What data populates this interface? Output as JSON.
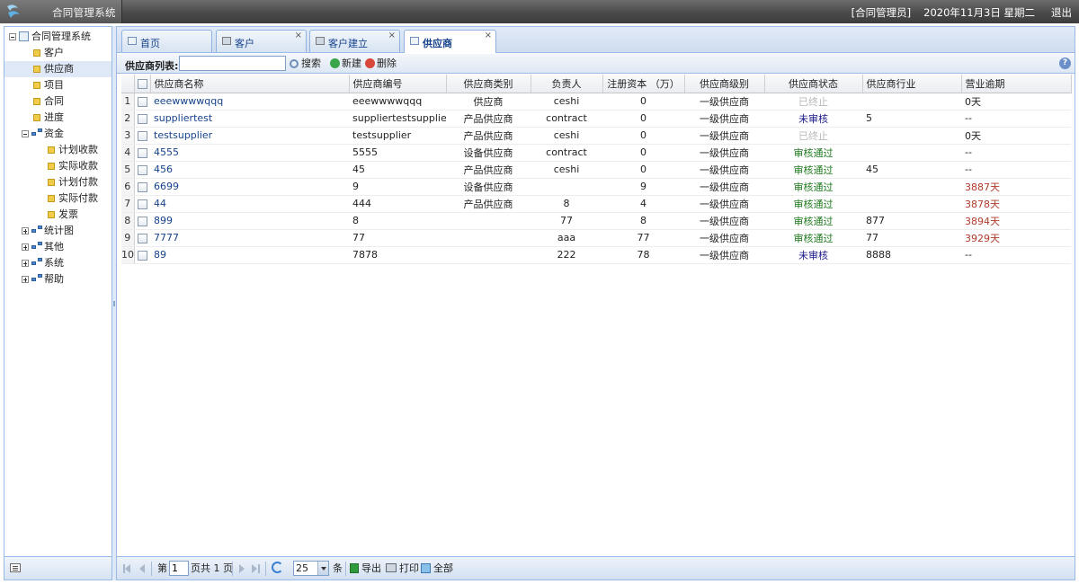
{
  "header": {
    "app_title": "合同管理系统",
    "user": "[合同管理员]",
    "date": "2020年11月3日 星期二",
    "logout": "退出"
  },
  "tree": {
    "root": "合同管理系统",
    "items": [
      {
        "label": "客户",
        "level": 1,
        "selected": false
      },
      {
        "label": "供应商",
        "level": 1,
        "selected": true
      },
      {
        "label": "项目",
        "level": 1,
        "selected": false
      },
      {
        "label": "合同",
        "level": 1,
        "selected": false
      },
      {
        "label": "进度",
        "level": 1,
        "selected": false
      },
      {
        "label": "资金",
        "level": 1,
        "expanded": true
      },
      {
        "label": "计划收款",
        "level": 2
      },
      {
        "label": "实际收款",
        "level": 2
      },
      {
        "label": "计划付款",
        "level": 2
      },
      {
        "label": "实际付款",
        "level": 2
      },
      {
        "label": "发票",
        "level": 2
      },
      {
        "label": "统计图",
        "level": 1,
        "expanded": false
      },
      {
        "label": "其他",
        "level": 1,
        "expanded": false
      },
      {
        "label": "系统",
        "level": 1,
        "expanded": false
      },
      {
        "label": "帮助",
        "level": 1,
        "expanded": false
      }
    ]
  },
  "tabs": [
    {
      "label": "首页",
      "active": false,
      "closable": false
    },
    {
      "label": "客户",
      "active": false,
      "closable": true
    },
    {
      "label": "客户建立",
      "active": false,
      "closable": true
    },
    {
      "label": "供应商",
      "active": true,
      "closable": true
    }
  ],
  "toolbar": {
    "list_label": "供应商列表:",
    "search_placeholder": "",
    "search": "搜索",
    "new": "新建",
    "delete": "删除"
  },
  "table": {
    "columns": [
      "",
      "",
      "供应商名称",
      "供应商编号",
      "供应商类别",
      "负责人",
      "注册资本 （万）",
      "供应商级别",
      "供应商状态",
      "供应商行业",
      "营业逾期"
    ],
    "rows": [
      {
        "no": "1",
        "name": "eeewwwwqqq",
        "code": "eeewwwwqqq",
        "category": "供应商",
        "owner": "ceshi",
        "capital": "0",
        "level": "一级供应商",
        "status": "已终止",
        "status_type": "ended",
        "industry": "",
        "overdue": "0天",
        "overdue_red": false
      },
      {
        "no": "2",
        "name": "suppliertest",
        "code": "suppliertestsuppliertest",
        "category": "产品供应商",
        "owner": "contract",
        "capital": "0",
        "level": "一级供应商",
        "status": "未审核",
        "status_type": "pending",
        "industry": "5",
        "overdue": "--",
        "overdue_red": false
      },
      {
        "no": "3",
        "name": "testsupplier",
        "code": "testsupplier",
        "category": "产品供应商",
        "owner": "ceshi",
        "capital": "0",
        "level": "一级供应商",
        "status": "已终止",
        "status_type": "ended",
        "industry": "",
        "overdue": "0天",
        "overdue_red": false
      },
      {
        "no": "4",
        "name": "4555",
        "code": "5555",
        "category": "设备供应商",
        "owner": "contract",
        "capital": "0",
        "level": "一级供应商",
        "status": "审核通过",
        "status_type": "approved",
        "industry": "",
        "overdue": "--",
        "overdue_red": false
      },
      {
        "no": "5",
        "name": "456",
        "code": "45",
        "category": "产品供应商",
        "owner": "ceshi",
        "capital": "0",
        "level": "一级供应商",
        "status": "审核通过",
        "status_type": "approved",
        "industry": "45",
        "overdue": "--",
        "overdue_red": false
      },
      {
        "no": "6",
        "name": "6699",
        "code": "9",
        "category": "设备供应商",
        "owner": "",
        "capital": "9",
        "level": "一级供应商",
        "status": "审核通过",
        "status_type": "approved",
        "industry": "",
        "overdue": "3887天",
        "overdue_red": true
      },
      {
        "no": "7",
        "name": "44",
        "code": "444",
        "category": "产品供应商",
        "owner": "8",
        "capital": "4",
        "level": "一级供应商",
        "status": "审核通过",
        "status_type": "approved",
        "industry": "",
        "overdue": "3878天",
        "overdue_red": true
      },
      {
        "no": "8",
        "name": "899",
        "code": "8",
        "category": "",
        "owner": "77",
        "capital": "8",
        "level": "一级供应商",
        "status": "审核通过",
        "status_type": "approved",
        "industry": "877",
        "overdue": "3894天",
        "overdue_red": true
      },
      {
        "no": "9",
        "name": "7777",
        "code": "77",
        "category": "",
        "owner": "aaa",
        "capital": "77",
        "level": "一级供应商",
        "status": "审核通过",
        "status_type": "approved",
        "industry": "77",
        "overdue": "3929天",
        "overdue_red": true
      },
      {
        "no": "10",
        "name": "89",
        "code": "7878",
        "category": "",
        "owner": "222",
        "capital": "78",
        "level": "一级供应商",
        "status": "未审核",
        "status_type": "pending",
        "industry": "8888",
        "overdue": "--",
        "overdue_red": false
      }
    ]
  },
  "pager": {
    "page_prefix": "第",
    "page_value": "1",
    "page_suffix": "页共 1 页",
    "page_size": "25",
    "size_suffix": "条",
    "export": "导出",
    "print": "打印",
    "all": "全部"
  }
}
